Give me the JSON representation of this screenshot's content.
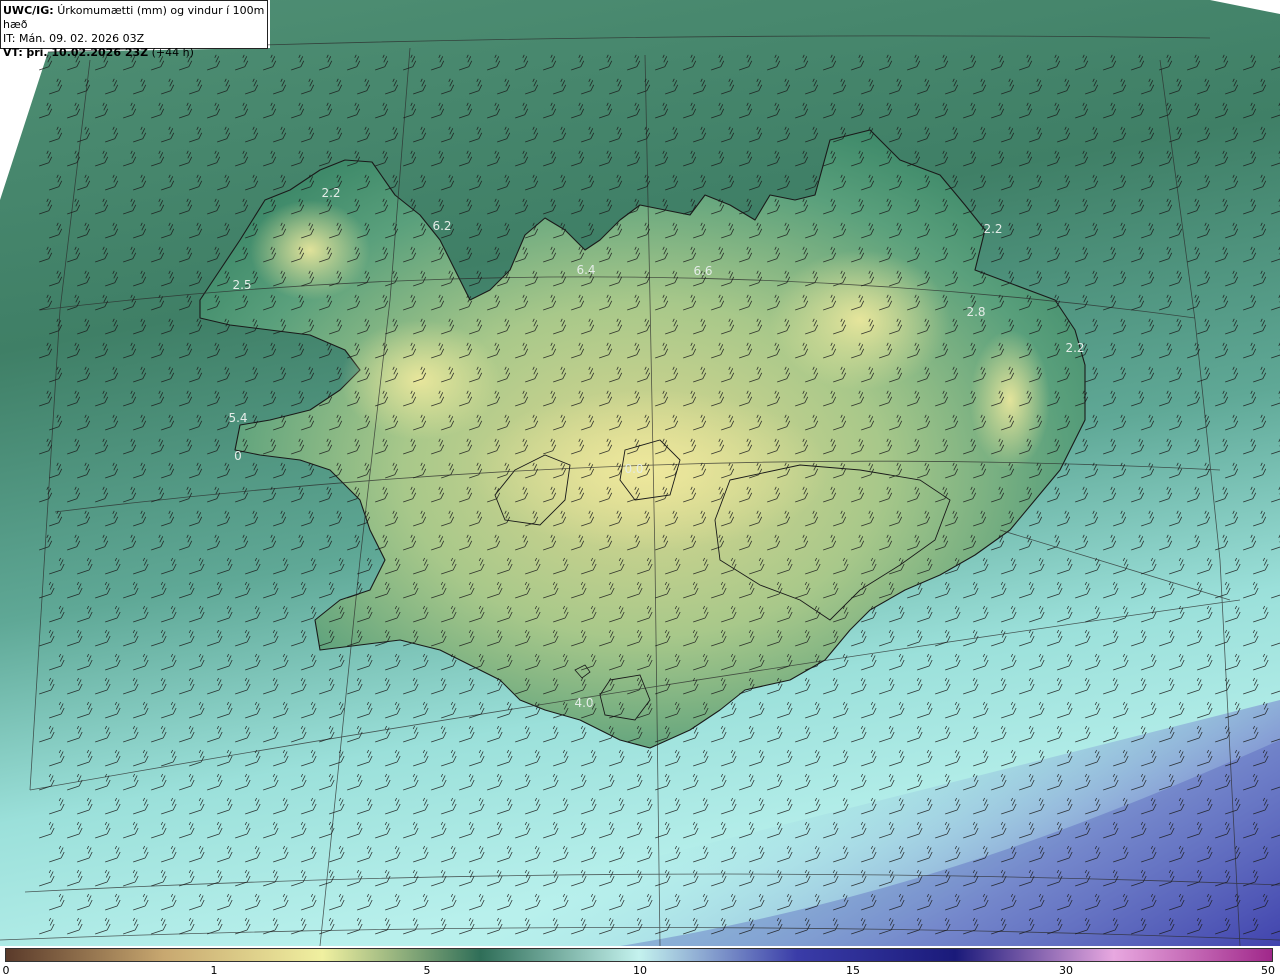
{
  "header": {
    "product": "UWC/IG:",
    "product_desc": "Úrkomumætti (mm) og vindur í 100m hæð",
    "it_label": "IT:",
    "it_value": "Mán. 09. 02. 2026 03Z",
    "vt_label": "VT:",
    "vt_value": "þri. 10.02.2026 23Z",
    "vt_lead": "(+44 h)"
  },
  "map": {
    "labels": [
      {
        "id": "westfjords-north",
        "text": "2.2"
      },
      {
        "id": "westfjords-east",
        "text": "6.2"
      },
      {
        "id": "westfjords-west",
        "text": "2.5"
      },
      {
        "id": "north-skagi",
        "text": "6.4"
      },
      {
        "id": "north-trollaskagi",
        "text": "6.6"
      },
      {
        "id": "northeast",
        "text": "2.2"
      },
      {
        "id": "east-inland",
        "text": "2.8"
      },
      {
        "id": "eastfjords",
        "text": "2.2"
      },
      {
        "id": "snaefellsnes-north",
        "text": "5.4"
      },
      {
        "id": "snaefellsnes-tip",
        "text": "0"
      },
      {
        "id": "hofsjokull",
        "text": "0.0"
      },
      {
        "id": "south-coast",
        "text": "4.0"
      }
    ],
    "colors": {
      "land_low": "#3f8c6a",
      "land_high": "#e8e49a",
      "sea_north": "#4a8a72",
      "sea_south": "#a8ece6",
      "sea_deep": "#6a74c4"
    }
  },
  "colorbar": {
    "ticks": [
      "0",
      "1",
      "5",
      "10",
      "15",
      "30",
      "50"
    ],
    "stops": [
      "#5a3a2a",
      "#c8a870",
      "#f0f0a0",
      "#2f6e58",
      "#c4f2ee",
      "#3a3ca8",
      "#1a1a7a",
      "#e8a8e0",
      "#a0288a"
    ]
  }
}
